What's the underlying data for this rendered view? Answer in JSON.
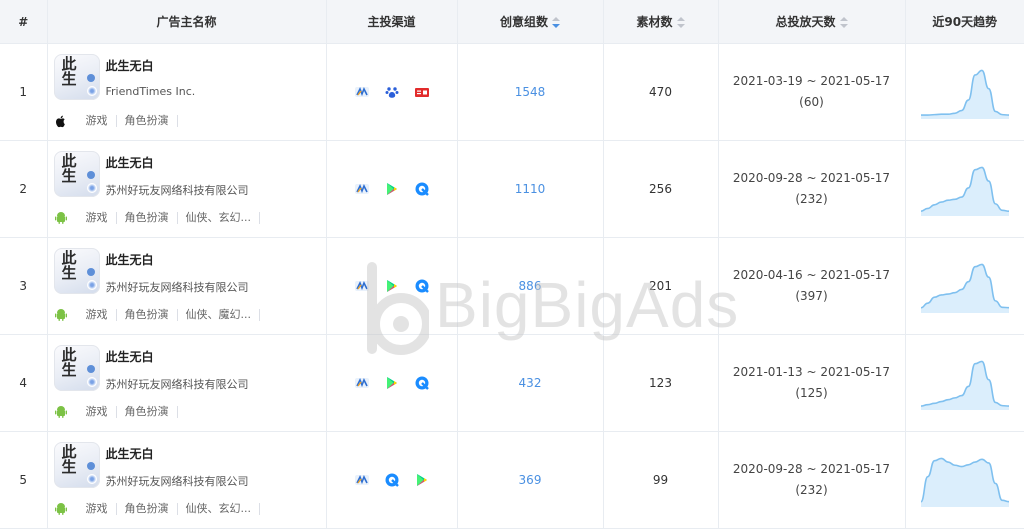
{
  "headers": {
    "index": "#",
    "advertiser": "广告主名称",
    "channel": "主投渠道",
    "creative_groups": "创意组数",
    "materials": "素材数",
    "days": "总投放天数",
    "trend": "近90天趋势"
  },
  "watermark": "BigBigAds",
  "rows": [
    {
      "index": "1",
      "name": "此生无白",
      "company": "FriendTimes Inc.",
      "os": "apple-icon",
      "tags": [
        "游戏",
        "角色扮演",
        ""
      ],
      "channels": [
        "mintegral-icon",
        "baidu-icon",
        "toutiao-icon"
      ],
      "creative_groups": "1548",
      "materials": "470",
      "date_range": "2021-03-19 ~ 2021-05-17",
      "days": "(60)",
      "trend": [
        0.02,
        0.02,
        0.03,
        0.04,
        0.04,
        0.06,
        0.12,
        0.35,
        0.9,
        1.0,
        0.6,
        0.1,
        0.03,
        0.02
      ]
    },
    {
      "index": "2",
      "name": "此生无白",
      "company": "苏州好玩友网络科技有限公司",
      "os": "android-icon",
      "tags": [
        "游戏",
        "角色扮演",
        "仙侠、玄幻..."
      ],
      "channels": [
        "mintegral-icon",
        "google-play-icon",
        "tencent-ads-icon"
      ],
      "creative_groups": "1110",
      "materials": "256",
      "date_range": "2020-09-28 ~ 2021-05-17",
      "days": "(232)",
      "trend": [
        0.04,
        0.1,
        0.18,
        0.24,
        0.28,
        0.3,
        0.35,
        0.55,
        0.95,
        1.0,
        0.7,
        0.2,
        0.06,
        0.04
      ]
    },
    {
      "index": "3",
      "name": "此生无白",
      "company": "苏州好玩友网络科技有限公司",
      "os": "android-icon",
      "tags": [
        "游戏",
        "角色扮演",
        "仙侠、魔幻..."
      ],
      "channels": [
        "mintegral-icon",
        "google-play-icon",
        "tencent-ads-icon"
      ],
      "creative_groups": "886",
      "materials": "201",
      "date_range": "2020-04-16 ~ 2021-05-17",
      "days": "(397)",
      "trend": [
        0.05,
        0.15,
        0.28,
        0.33,
        0.35,
        0.38,
        0.45,
        0.62,
        0.95,
        1.0,
        0.72,
        0.2,
        0.06,
        0.05
      ]
    },
    {
      "index": "4",
      "name": "此生无白",
      "company": "苏州好玩友网络科技有限公司",
      "os": "android-icon",
      "tags": [
        "游戏",
        "角色扮演",
        ""
      ],
      "channels": [
        "mintegral-icon",
        "google-play-icon",
        "tencent-ads-icon"
      ],
      "creative_groups": "432",
      "materials": "123",
      "date_range": "2021-01-13 ~ 2021-05-17",
      "days": "(125)",
      "trend": [
        0.02,
        0.05,
        0.08,
        0.12,
        0.16,
        0.2,
        0.25,
        0.45,
        0.95,
        1.0,
        0.6,
        0.1,
        0.03,
        0.02
      ]
    },
    {
      "index": "5",
      "name": "此生无白",
      "company": "苏州好玩友网络科技有限公司",
      "os": "android-icon",
      "tags": [
        "游戏",
        "角色扮演",
        "仙侠、玄幻..."
      ],
      "channels": [
        "mintegral-icon",
        "tencent-ads-icon",
        "google-play-icon"
      ],
      "creative_groups": "369",
      "materials": "99",
      "date_range": "2020-09-28 ~ 2021-05-17",
      "days": "(232)",
      "trend": [
        0.05,
        0.6,
        0.95,
        1.0,
        0.92,
        0.85,
        0.82,
        0.86,
        0.92,
        0.98,
        0.9,
        0.45,
        0.08,
        0.05
      ]
    }
  ]
}
